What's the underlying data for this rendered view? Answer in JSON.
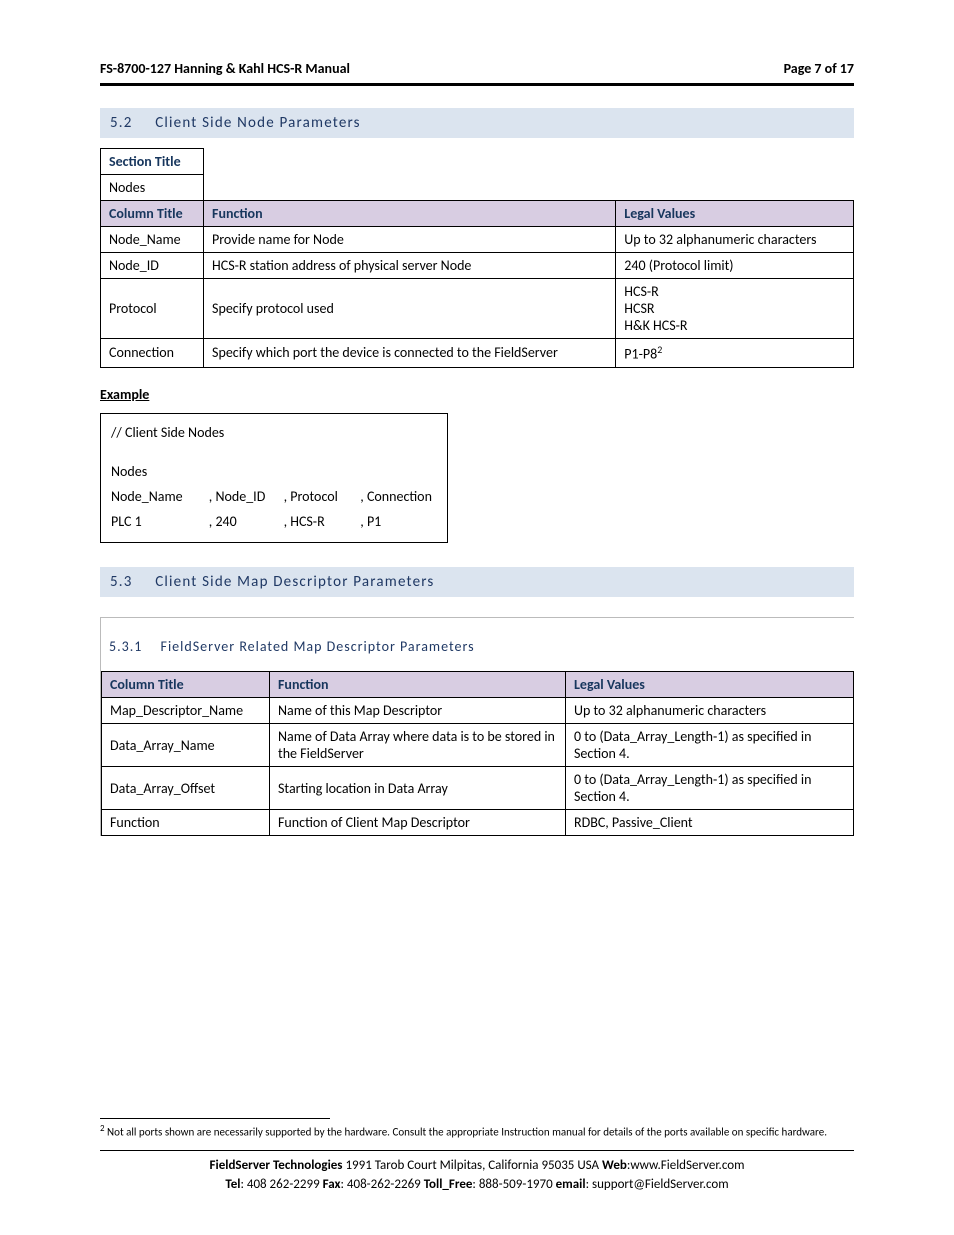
{
  "header": {
    "title_left": "FS-8700-127 Hanning & Kahl HCS-R Manual",
    "title_right": "Page 7 of 17"
  },
  "section52": {
    "number": "5.2",
    "title": "Client Side Node Parameters",
    "table": {
      "section_title_label": "Section Title",
      "section_title_value": "Nodes",
      "column_title_label": "Column Title",
      "function_label": "Function",
      "legal_values_label": "Legal Values",
      "rows": [
        {
          "col": "Node_Name",
          "func": "Provide name for Node",
          "legal": "Up to 32 alphanumeric characters"
        },
        {
          "col": "Node_ID",
          "func": "HCS-R station address of physical server Node",
          "legal": "240 (Protocol limit)"
        },
        {
          "col": "Protocol",
          "func": "Specify protocol used",
          "legal_lines": [
            "HCS-R",
            "HCSR",
            "H&K HCS-R"
          ]
        },
        {
          "col": "Connection",
          "func": "Specify which port the device is connected to the FieldServer",
          "legal": "P1-P8",
          "legal_sup": "2"
        }
      ]
    },
    "example_label": "Example",
    "example": {
      "comment": "//     Client Side Nodes",
      "header": "Nodes",
      "cols": [
        "Node_Name",
        ", Node_ID",
        ", Protocol",
        ", Connection"
      ],
      "vals": [
        "PLC 1",
        ", 240",
        ", HCS-R",
        ", P1"
      ]
    }
  },
  "section53": {
    "number": "5.3",
    "title": "Client Side Map Descriptor Parameters"
  },
  "section531": {
    "number": "5.3.1",
    "title": "FieldServer Related Map Descriptor Parameters",
    "table": {
      "column_title_label": "Column Title",
      "function_label": "Function",
      "legal_values_label": "Legal Values",
      "rows": [
        {
          "col": "Map_Descriptor_Name",
          "func": "Name of this Map Descriptor",
          "legal": "Up to 32 alphanumeric characters"
        },
        {
          "col": "Data_Array_Name",
          "func": "Name of Data Array where data is to be stored in the FieldServer",
          "legal": "0 to (Data_Array_Length-1) as specified in Section 4."
        },
        {
          "col": "Data_Array_Offset",
          "func": "Starting location in Data Array",
          "legal": "0 to (Data_Array_Length-1) as specified in Section 4."
        },
        {
          "col": "Function",
          "func": "Function of Client Map Descriptor",
          "legal": "RDBC, Passive_Client"
        }
      ]
    }
  },
  "footnote": {
    "num": "2",
    "text": " Not all ports shown are necessarily supported by the hardware. Consult the appropriate Instruction manual for details of the ports available on specific hardware."
  },
  "footer": {
    "company": "FieldServer Technologies",
    "address": " 1991 Tarob Court Milpitas, California 95035 USA  ",
    "web_label": "Web",
    "web_value": ":www.FieldServer.com",
    "tel_label": "Tel",
    "tel_value": ": 408 262-2299   ",
    "fax_label": "Fax",
    "fax_value": ": 408-262-2269   ",
    "toll_label": "Toll_Free",
    "toll_value": ": 888-509-1970   ",
    "email_label": "email",
    "email_value": ": support@FieldServer.com"
  }
}
